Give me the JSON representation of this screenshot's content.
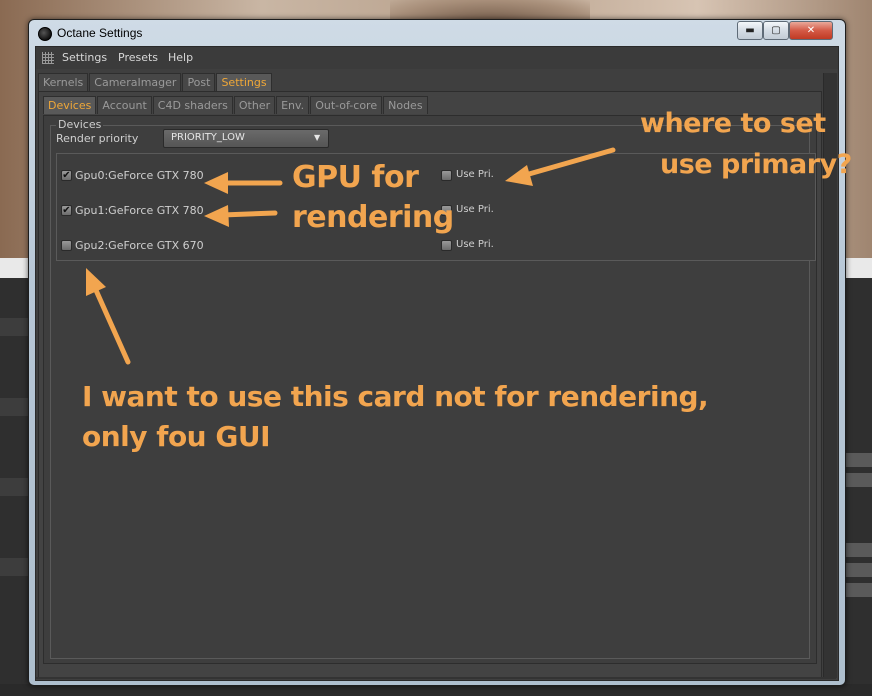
{
  "window": {
    "title": "Octane Settings",
    "controls": {
      "minimize": "▬",
      "maximize": "▢",
      "close": "✕"
    }
  },
  "menu": [
    "Settings",
    "Presets",
    "Help"
  ],
  "main_tabs": [
    "Kernels",
    "CameraImager",
    "Post",
    "Settings"
  ],
  "main_tab_active": "Settings",
  "sub_tabs": [
    "Devices",
    "Account",
    "C4D shaders",
    "Other",
    "Env.",
    "Out-of-core",
    "Nodes"
  ],
  "sub_tab_active": "Devices",
  "devices": {
    "group_title": "Devices",
    "priority_label": "Render priority",
    "priority_value": "PRIORITY_LOW",
    "gpus": [
      {
        "name": "Gpu0:GeForce GTX 780",
        "checked": true,
        "use_pri_label": "Use Pri.",
        "use_pri_checked": false
      },
      {
        "name": "Gpu1:GeForce GTX 780",
        "checked": true,
        "use_pri_label": "Use Pri.",
        "use_pri_checked": false
      },
      {
        "name": "Gpu2:GeForce GTX 670",
        "checked": false,
        "use_pri_label": "Use Pri.",
        "use_pri_checked": false
      }
    ]
  },
  "annotations": {
    "gpu_for_rendering_line1": "GPU for",
    "gpu_for_rendering_line2": "rendering",
    "where_to_set_line1": "where to set",
    "where_to_set_line2": "use primary?",
    "want_card_line1": "I want to use this card not for rendering,",
    "want_card_line2": "only fou GUI",
    "color": "#f2a54f"
  },
  "colors": {
    "accent_tab": "#f0a838",
    "panel_bg": "#3f3f3f"
  }
}
